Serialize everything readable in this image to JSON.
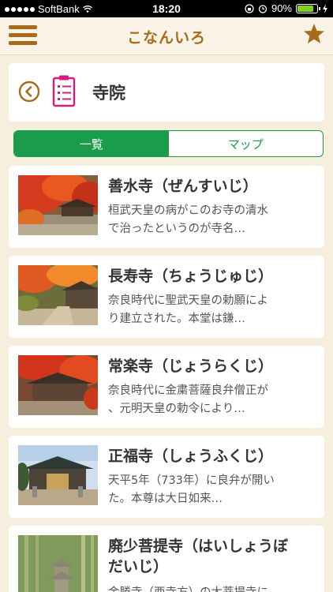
{
  "status_bar": {
    "carrier": "SoftBank",
    "time": "18:20",
    "battery": "90%"
  },
  "nav": {
    "title": "こなんいろ",
    "menu_icon": "hamburger-icon",
    "favorite_icon": "star-icon",
    "accent_color": "#a76b1a"
  },
  "category": {
    "title": "寺院",
    "back_icon": "back-circle-icon",
    "category_icon": "clipboard-icon"
  },
  "tabs": {
    "list_label": "一覧",
    "map_label": "マップ",
    "selected": "一覧",
    "accent_color": "#1b9c4a"
  },
  "items": [
    {
      "title": "善水寺（ぜんすいじ）",
      "desc_line1": "桓武天皇の病がこのお寺の清水",
      "desc_line2": "で治ったというのが寺名…"
    },
    {
      "title": "長寿寺（ちょうじゅじ）",
      "desc_line1": "奈良時代に聖武天皇の勅願によ",
      "desc_line2": "り建立された。本堂は鎌…"
    },
    {
      "title": "常楽寺（じょうらくじ）",
      "desc_line1": "奈良時代に金粛菩薩良弁僧正が",
      "desc_line2": "、元明天皇の勅令により…"
    },
    {
      "title": "正福寺（しょうふくじ）",
      "desc_line1": "天平5年（733年）に良弁が開い",
      "desc_line2": "た。本尊は大日如来…"
    },
    {
      "title_line1": "廃少菩提寺（はいしょうぼ",
      "title_line2": "だいじ）",
      "desc_line1": "金勝寺（西寺方）の大菩提寺に"
    }
  ]
}
